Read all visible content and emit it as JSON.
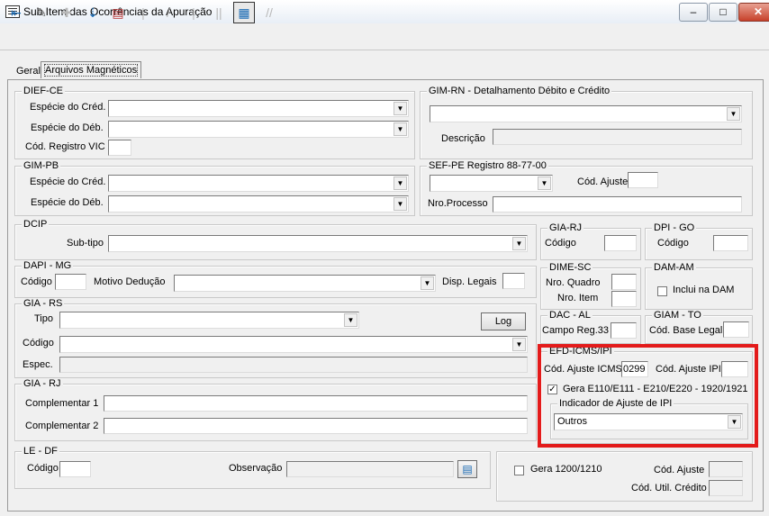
{
  "window": {
    "title": "Sub Item das Ocorrências da Apuração",
    "minimize_label": "▭",
    "maximize_label": "▢",
    "close_label": "✕"
  },
  "tabs": {
    "geral": "Geral",
    "arquivos": "Arquivos Magnéticos"
  },
  "dief_ce": {
    "legend": "DIEF-CE",
    "especie_cred": "Espécie do Créd.",
    "especie_deb": "Espécie do Déb.",
    "cod_registro": "Cód. Registro VIC"
  },
  "gim_rn": {
    "legend": "GIM-RN - Detalhamento Débito e Crédito",
    "descricao": "Descrição"
  },
  "gim_pb": {
    "legend": "GIM-PB",
    "especie_cred": "Espécie do Créd.",
    "especie_deb": "Espécie do Déb."
  },
  "sef_pe": {
    "legend": "SEF-PE Registro 88-77-00",
    "cod_ajuste": "Cód. Ajuste",
    "nro_processo": "Nro.Processo"
  },
  "dcip": {
    "legend": "DCIP",
    "subtipo": "Sub-tipo"
  },
  "gia_rj1": {
    "legend": "GIA-RJ",
    "codigo": "Código"
  },
  "dpi_go": {
    "legend": "DPI - GO",
    "codigo": "Código"
  },
  "dapi_mg": {
    "legend": "DAPI - MG",
    "codigo": "Código",
    "motivo": "Motivo Dedução",
    "disp": "Disp. Legais"
  },
  "dime_sc": {
    "legend": "DIME-SC",
    "nro_quadro": "Nro. Quadro",
    "nro_item": "Nro. Item"
  },
  "dam_am": {
    "legend": "DAM-AM",
    "inclui": "Inclui na DAM"
  },
  "gia_rs": {
    "legend": "GIA - RS",
    "tipo": "Tipo",
    "log": "Log",
    "codigo": "Código",
    "espec": "Espec."
  },
  "dac_al": {
    "legend": "DAC - AL",
    "campo": "Campo Reg.33"
  },
  "giam_to": {
    "legend": "GIAM - TO",
    "cod_base": "Cód. Base Legal"
  },
  "efd": {
    "legend": "EFD-ICMS/IPI",
    "cod_ajuste_icms": "Cód. Ajuste ICMS",
    "cod_ajuste_icms_value": "0299",
    "cod_ajuste_ipi": "Cód. Ajuste IPI",
    "gera": "Gera E110/E111 - E210/E220 - 1920/1921",
    "indicador_legend": "Indicador de Ajuste de IPI",
    "indicador_value": "Outros"
  },
  "gia_rj2": {
    "legend": "GIA - RJ",
    "complementar1": "Complementar 1",
    "complementar2": "Complementar 2"
  },
  "le_df": {
    "legend": "LE - DF",
    "codigo": "Código",
    "observacao": "Observação"
  },
  "gera1200": {
    "label": "Gera 1200/1210",
    "cod_ajuste": "Cód. Ajuste",
    "cod_util": "Cód. Util. Crédito"
  },
  "colors": {
    "highlight": "#e31b1b"
  }
}
